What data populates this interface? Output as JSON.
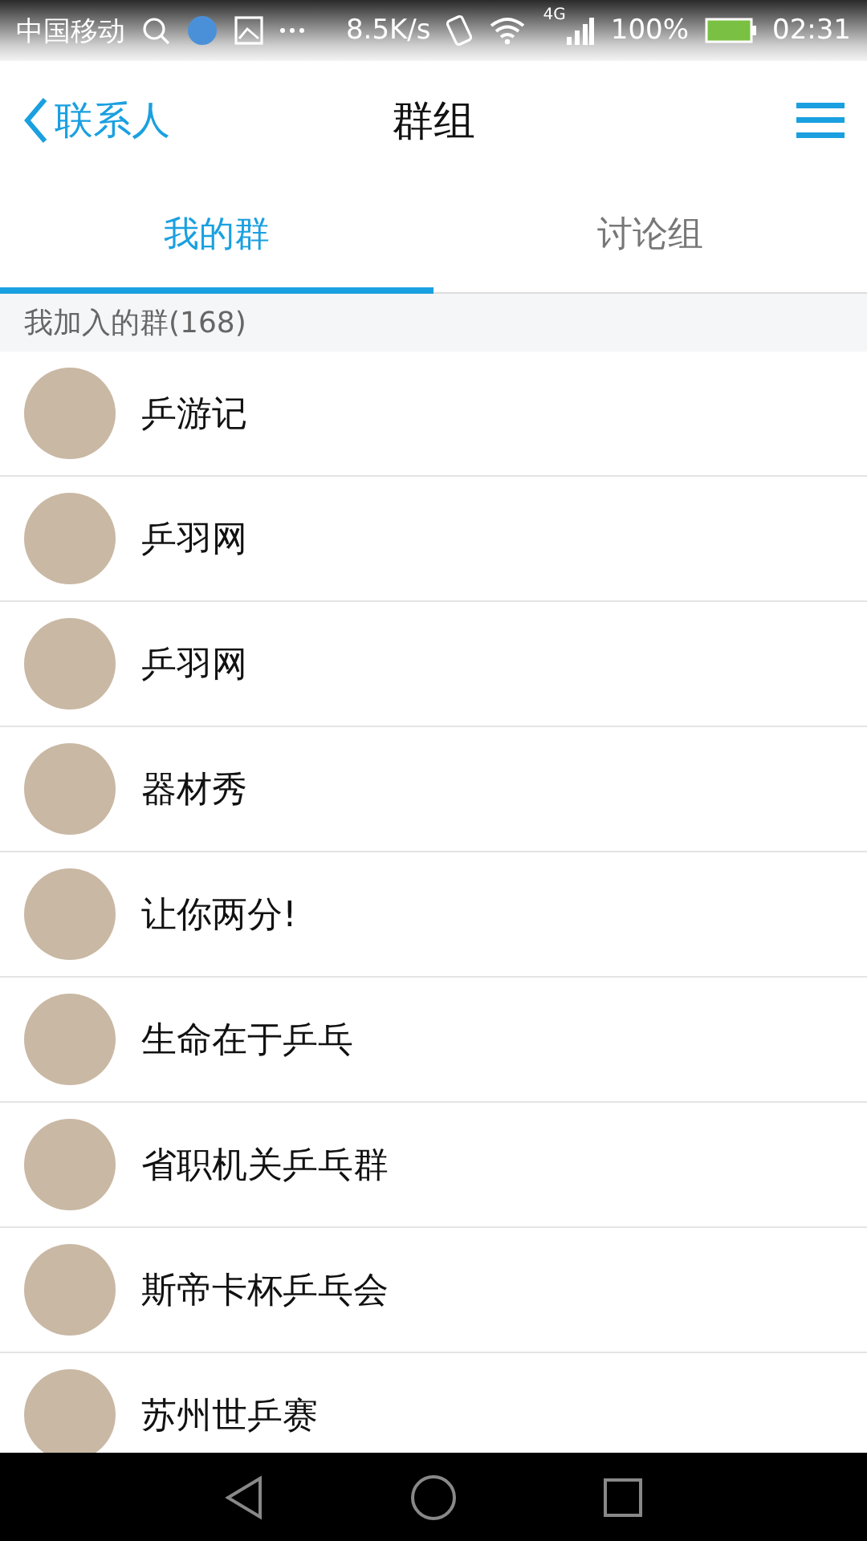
{
  "status_bar": {
    "carrier": "中国移动",
    "speed": "8.5K/s",
    "network": "4G",
    "battery": "100%",
    "time": "02:31"
  },
  "header": {
    "back": "联系人",
    "title": "群组"
  },
  "tabs": [
    {
      "label": "我的群",
      "selected": true
    },
    {
      "label": "讨论组",
      "selected": false
    }
  ],
  "section": {
    "title": "我加入的群(168)"
  },
  "groups": [
    {
      "name": "乒游记"
    },
    {
      "name": "乒羽网"
    },
    {
      "name": "乒羽网"
    },
    {
      "name": "器材秀"
    },
    {
      "name": "让你两分!"
    },
    {
      "name": "生命在于乒乓"
    },
    {
      "name": "省职机关乒乓群"
    },
    {
      "name": "斯帝卡杯乒乓会"
    },
    {
      "name": "苏州世乒赛"
    }
  ]
}
